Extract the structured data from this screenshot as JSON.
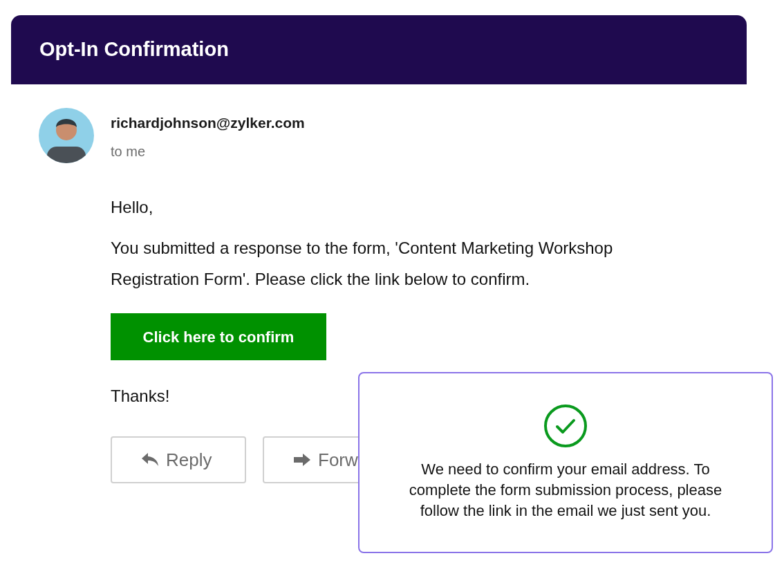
{
  "header": {
    "title": "Opt-In Confirmation"
  },
  "message": {
    "sender": "richardjohnson@zylker.com",
    "recipient": "to me",
    "greeting": "Hello,",
    "body": "You submitted a response to the form, 'Content Marketing Workshop Registration Form'. Please click the link below to confirm.",
    "confirm_button": "Click here to confirm",
    "closing": "Thanks!"
  },
  "actions": [
    {
      "kind": "reply",
      "label": "Reply"
    },
    {
      "kind": "forward",
      "label": "Forw"
    }
  ],
  "popup": {
    "text": "We need to confirm your email address. To complete the form submission process, please follow the link in the email we just sent you."
  }
}
